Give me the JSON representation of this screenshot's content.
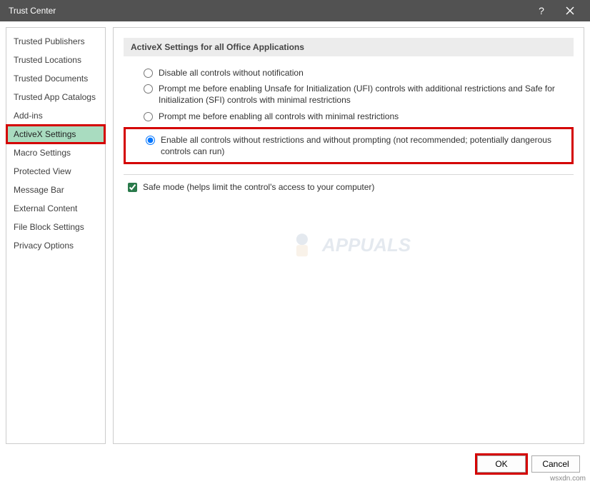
{
  "titlebar": {
    "title": "Trust Center"
  },
  "sidebar": {
    "items": [
      {
        "label": "Trusted Publishers"
      },
      {
        "label": "Trusted Locations"
      },
      {
        "label": "Trusted Documents"
      },
      {
        "label": "Trusted App Catalogs"
      },
      {
        "label": "Add-ins"
      },
      {
        "label": "ActiveX Settings"
      },
      {
        "label": "Macro Settings"
      },
      {
        "label": "Protected View"
      },
      {
        "label": "Message Bar"
      },
      {
        "label": "External Content"
      },
      {
        "label": "File Block Settings"
      },
      {
        "label": "Privacy Options"
      }
    ]
  },
  "section": {
    "heading": "ActiveX Settings for all Office Applications",
    "options": [
      "Disable all controls without notification",
      "Prompt me before enabling Unsafe for Initialization (UFI) controls with additional restrictions and Safe for Initialization (SFI) controls with minimal restrictions",
      "Prompt me before enabling all controls with minimal restrictions",
      "Enable all controls without restrictions and without prompting (not recommended; potentially dangerous controls can run)"
    ],
    "safe_mode": "Safe mode (helps limit the control's access to your computer)"
  },
  "buttons": {
    "ok": "OK",
    "cancel": "Cancel"
  },
  "watermark": "APPUALS",
  "source": "wsxdn.com"
}
